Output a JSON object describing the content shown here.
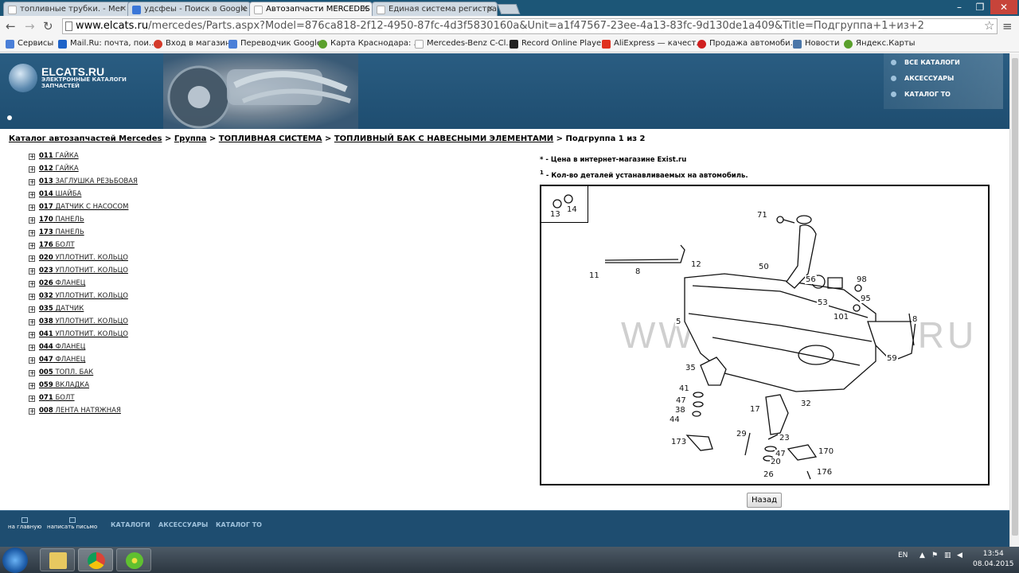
{
  "browser": {
    "tabs": [
      {
        "title": "топливные трубки. - Mer",
        "icon_color": "#ffffff"
      },
      {
        "title": "удсфеы - Поиск в Google",
        "icon_color": "#3b77d8"
      },
      {
        "title": "Автозапчасти MERCEDES",
        "icon_color": "#ffffff"
      },
      {
        "title": "Единая система регистрац",
        "icon_color": "#ffffff"
      }
    ],
    "url_domain": "www.elcats.ru",
    "url_path": "/mercedes/Parts.aspx?Model=876ca818-2f12-4950-87fc-4d3f5830160a&Unit=a1f47567-23ee-4a13-83fc-9d130de1a409&Title=Подгруппа+1+из+2",
    "bookmarks": [
      {
        "label": "Сервисы",
        "icon_color": "#4a7fd8"
      },
      {
        "label": "Mail.Ru: почта, пои...",
        "icon_color": "#1e63c8"
      },
      {
        "label": "Вход в магазин",
        "icon_color": "#d43a2a"
      },
      {
        "label": "Переводчик Google",
        "icon_color": "#4a7fd8"
      },
      {
        "label": "Карта Краснодара: ...",
        "icon_color": "#5aa02c"
      },
      {
        "label": "Mercedes-Benz C-Cl...",
        "icon_color": "#dddddd"
      },
      {
        "label": "Record Online Player",
        "icon_color": "#222222"
      },
      {
        "label": "AliExpress — качест...",
        "icon_color": "#e0311f"
      },
      {
        "label": "Продажа автомоби...",
        "icon_color": "#d02020"
      },
      {
        "label": "Новости",
        "icon_color": "#4a76a8"
      },
      {
        "label": "Яндекс.Карты",
        "icon_color": "#5aa02c"
      }
    ]
  },
  "site": {
    "logo_title": "ELCATS.RU",
    "logo_subtitle": "ЭЛЕКТРОННЫЕ КАТАЛОГИ ЗАПЧАСТЕЙ",
    "top_nav": [
      "ВСЕ КАТАЛОГИ",
      "АКСЕССУАРЫ",
      "КАТАЛОГ ТО"
    ]
  },
  "breadcrumb": {
    "items": [
      "Каталог автозапчастей Mercedes",
      "Группа",
      "ТОПЛИВНАЯ СИСТЕМА",
      "ТОПЛИВНЫЙ БАК С НАВЕСНЫМИ ЭЛЕМЕНТАМИ"
    ],
    "separator": ">",
    "current": "Подгруппа 1 из 2"
  },
  "parts": [
    {
      "num": "011",
      "name": "ГАЙКА"
    },
    {
      "num": "012",
      "name": "ГАЙКА"
    },
    {
      "num": "013",
      "name": "ЗАГЛУШКА РЕЗЬБОВАЯ"
    },
    {
      "num": "014",
      "name": "ШАЙБА"
    },
    {
      "num": "017",
      "name": "ДАТЧИК С НАСОСОМ"
    },
    {
      "num": "170",
      "name": "ПАНЕЛЬ"
    },
    {
      "num": "173",
      "name": "ПАНЕЛЬ"
    },
    {
      "num": "176",
      "name": "БОЛТ"
    },
    {
      "num": "020",
      "name": "УПЛОТНИТ. КОЛЬЦО"
    },
    {
      "num": "023",
      "name": "УПЛОТНИТ. КОЛЬЦО"
    },
    {
      "num": "026",
      "name": "ФЛАНЕЦ"
    },
    {
      "num": "032",
      "name": "УПЛОТНИТ. КОЛЬЦО"
    },
    {
      "num": "035",
      "name": "ДАТЧИК"
    },
    {
      "num": "038",
      "name": "УПЛОТНИТ. КОЛЬЦО"
    },
    {
      "num": "041",
      "name": "УПЛОТНИТ. КОЛЬЦО"
    },
    {
      "num": "044",
      "name": "ФЛАНЕЦ"
    },
    {
      "num": "047",
      "name": "ФЛАНЕЦ"
    },
    {
      "num": "005",
      "name": "ТОПЛ. БАК"
    },
    {
      "num": "059",
      "name": "ВКЛАДКА"
    },
    {
      "num": "071",
      "name": "БОЛТ"
    },
    {
      "num": "008",
      "name": "ЛЕНТА НАТЯЖНАЯ"
    }
  ],
  "notes": [
    {
      "mark": "*",
      "text": " - Цена в интернет-магазине Exist.ru"
    },
    {
      "mark": "1",
      "text": " - Кол-во деталей устанавливаемых на автомобиль."
    }
  ],
  "diagram": {
    "watermark": "WWW.ELCATS.RU",
    "callouts": [
      "13",
      "14",
      "71",
      "12",
      "11",
      "8",
      "50",
      "56",
      "98",
      "53",
      "95",
      "101",
      "5",
      "8",
      "59",
      "35",
      "41",
      "47",
      "38",
      "44",
      "17",
      "32",
      "29",
      "23",
      "173",
      "47",
      "20",
      "170",
      "26",
      "176"
    ]
  },
  "back_button": "Назад",
  "footer": {
    "home": "на главную",
    "mail": "написать письмо",
    "links": [
      "КАТАЛОГИ",
      "АКСЕССУАРЫ",
      "КАТАЛОГ ТО"
    ]
  },
  "taskbar": {
    "lang": "EN",
    "time": "13:54",
    "date": "08.04.2015"
  }
}
